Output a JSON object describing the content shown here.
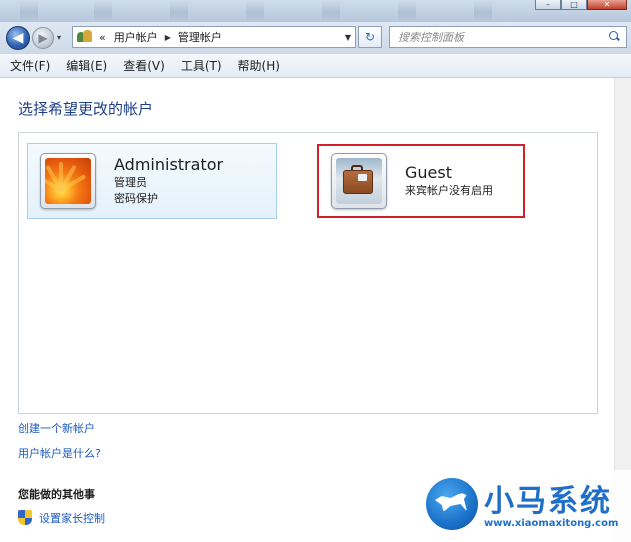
{
  "navigation": {
    "back_glyph": "◀",
    "forward_glyph": "▶",
    "recent_glyph": "▾",
    "breadcrumb_prefix": "«",
    "breadcrumb": [
      "用户帐户",
      "管理帐户"
    ],
    "separator_glyph": "▶",
    "dropdown_glyph": "▼",
    "refresh_glyph": "↻",
    "search_placeholder": "搜索控制面板"
  },
  "window_controls": {
    "minimize": "–",
    "maximize": "□",
    "close": "✕"
  },
  "menubar": {
    "items": [
      "文件(F)",
      "编辑(E)",
      "查看(V)",
      "工具(T)",
      "帮助(H)"
    ]
  },
  "content": {
    "heading": "选择希望更改的帐户",
    "accounts": [
      {
        "name": "Administrator",
        "role": "管理员",
        "status": "密码保护",
        "avatar": "flower-avatar",
        "selected": true
      },
      {
        "name": "Guest",
        "status": "来宾帐户没有启用",
        "avatar": "suitcase-avatar",
        "highlighted": true,
        "highlight_color": "#d0202a"
      }
    ],
    "links": {
      "create_account": "创建一个新帐户",
      "what_is_account": "用户帐户是什么?"
    },
    "other_section": {
      "heading": "您能做的其他事",
      "parental_control": "设置家长控制"
    }
  },
  "watermark": {
    "brand": "小马系统",
    "url": "www.xiaomaxitong.com"
  },
  "colors": {
    "link": "#1c5bbf",
    "heading": "#1e3f8a",
    "highlight": "#d0202a",
    "watermark": "#1f6fc8"
  }
}
